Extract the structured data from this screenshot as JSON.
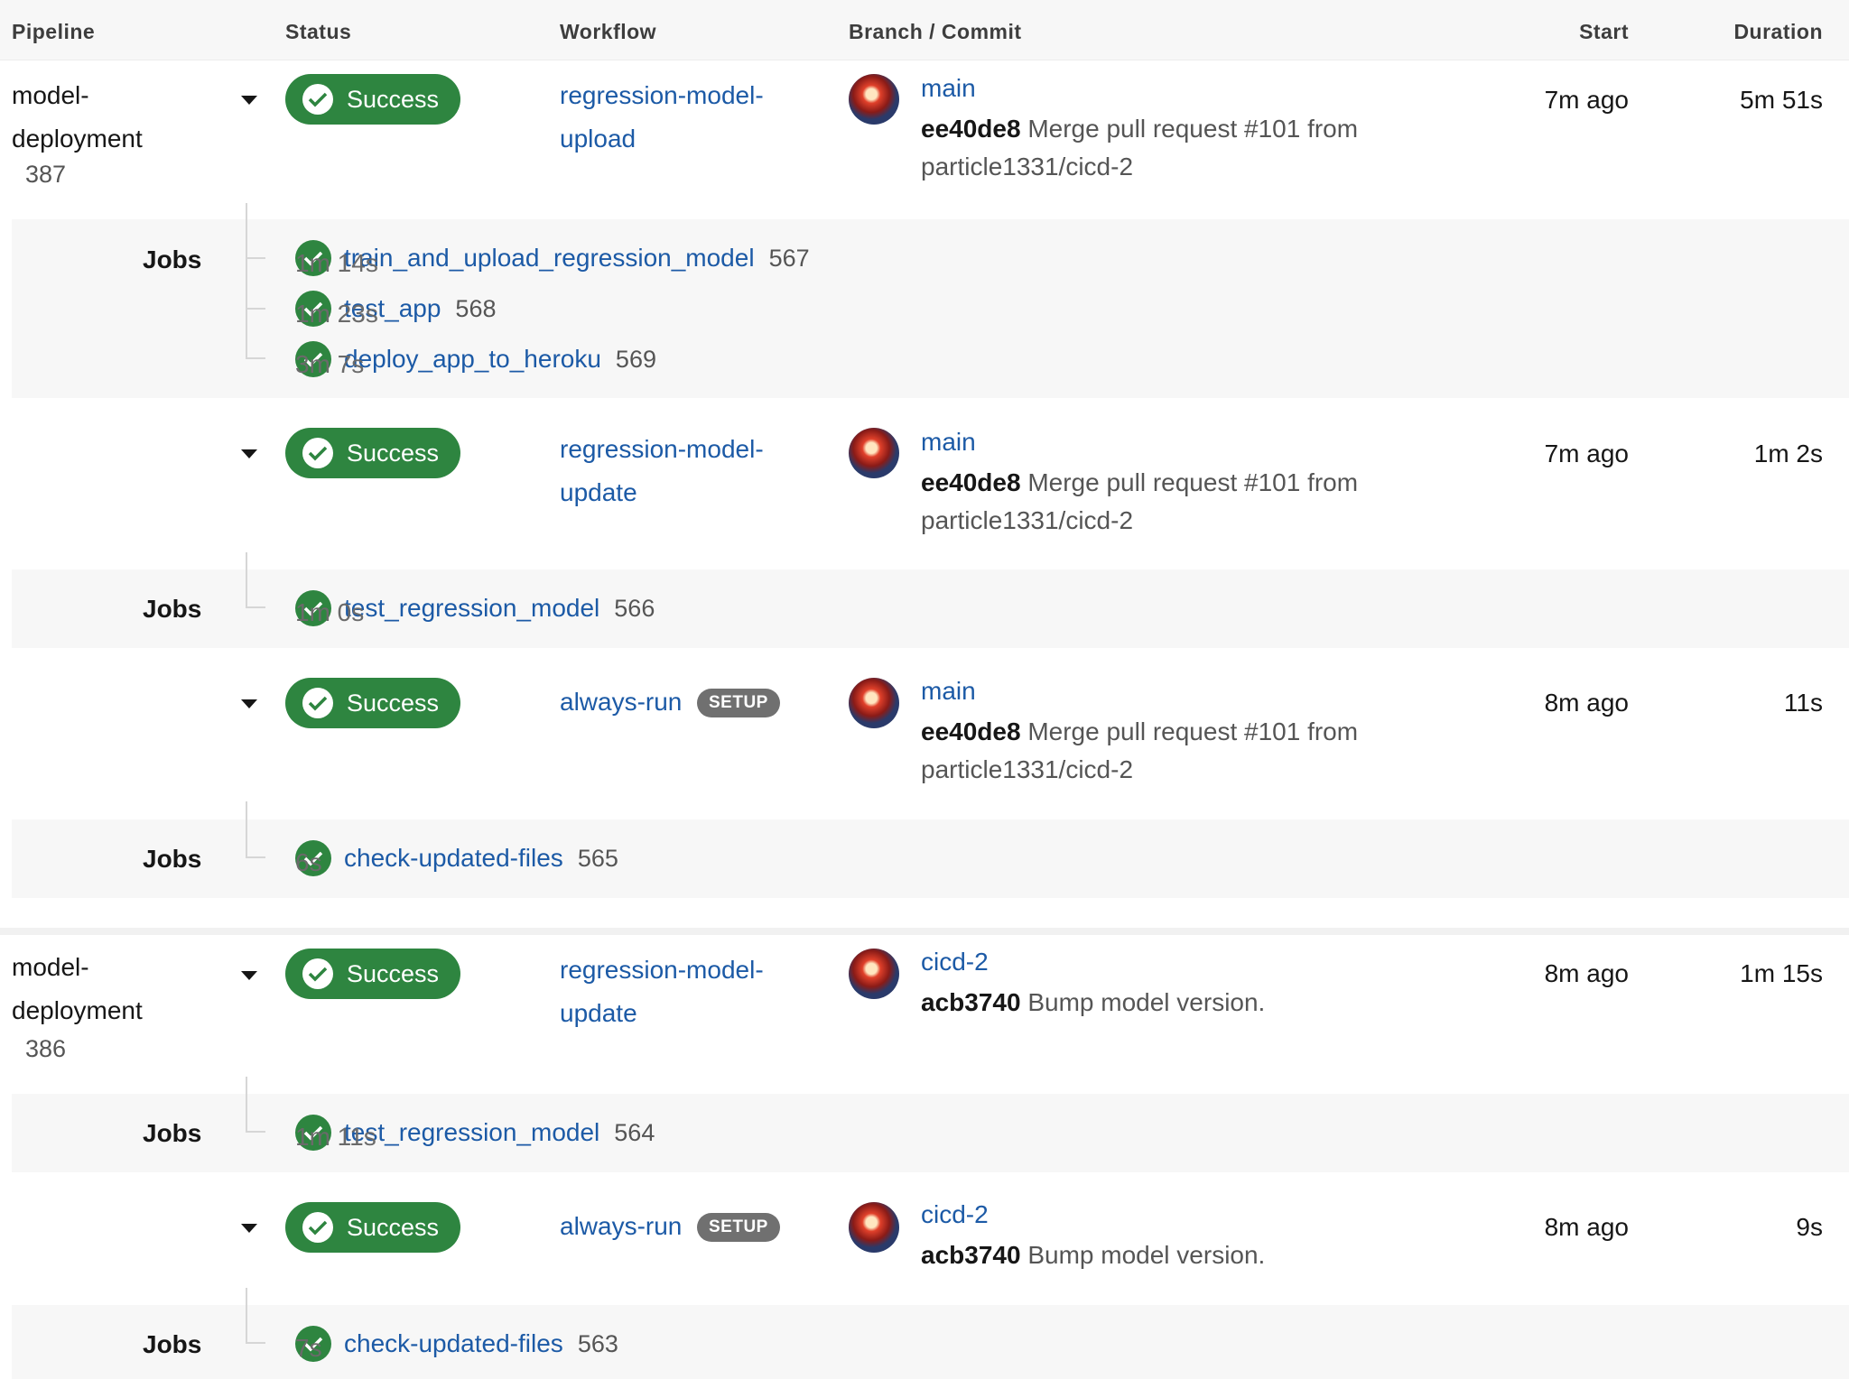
{
  "header": {
    "pipeline": "Pipeline",
    "status": "Status",
    "workflow": "Workflow",
    "branch_commit": "Branch / Commit",
    "start": "Start",
    "duration": "Duration"
  },
  "colors": {
    "success": "#2e8540",
    "link": "#1c5aa6",
    "setup_badge": "#707070"
  },
  "jobs_label": "Jobs",
  "pipelines": [
    {
      "name": "model-deployment",
      "number": "387",
      "workflows": [
        {
          "status": "Success",
          "name": "regression-model-upload",
          "branch": "main",
          "sha": "ee40de8",
          "message": "Merge pull request #101 from particle1331/cicd-2",
          "start": "7m ago",
          "duration": "5m 51s",
          "jobs": [
            {
              "name": "train_and_upload_regression_model",
              "number": "567",
              "duration": "1m 14s"
            },
            {
              "name": "test_app",
              "number": "568",
              "duration": "1m 23s"
            },
            {
              "name": "deploy_app_to_heroku",
              "number": "569",
              "duration": "3m 7s"
            }
          ]
        },
        {
          "status": "Success",
          "name": "regression-model-update",
          "branch": "main",
          "sha": "ee40de8",
          "message": "Merge pull request #101 from particle1331/cicd-2",
          "start": "7m ago",
          "duration": "1m 2s",
          "jobs": [
            {
              "name": "test_regression_model",
              "number": "566",
              "duration": "1m 0s"
            }
          ]
        },
        {
          "status": "Success",
          "name": "always-run",
          "tag": "SETUP",
          "branch": "main",
          "sha": "ee40de8",
          "message": "Merge pull request #101 from particle1331/cicd-2",
          "start": "8m ago",
          "duration": "11s",
          "jobs": [
            {
              "name": "check-updated-files",
              "number": "565",
              "duration": "6s"
            }
          ]
        }
      ]
    },
    {
      "name": "model-deployment",
      "number": "386",
      "workflows": [
        {
          "status": "Success",
          "name": "regression-model-update",
          "branch": "cicd-2",
          "sha": "acb3740",
          "message": "Bump model version.",
          "start": "8m ago",
          "duration": "1m 15s",
          "jobs": [
            {
              "name": "test_regression_model",
              "number": "564",
              "duration": "1m 11s"
            }
          ]
        },
        {
          "status": "Success",
          "name": "always-run",
          "tag": "SETUP",
          "branch": "cicd-2",
          "sha": "acb3740",
          "message": "Bump model version.",
          "start": "8m ago",
          "duration": "9s",
          "jobs": [
            {
              "name": "check-updated-files",
              "number": "563",
              "duration": "7s"
            }
          ]
        }
      ]
    }
  ]
}
